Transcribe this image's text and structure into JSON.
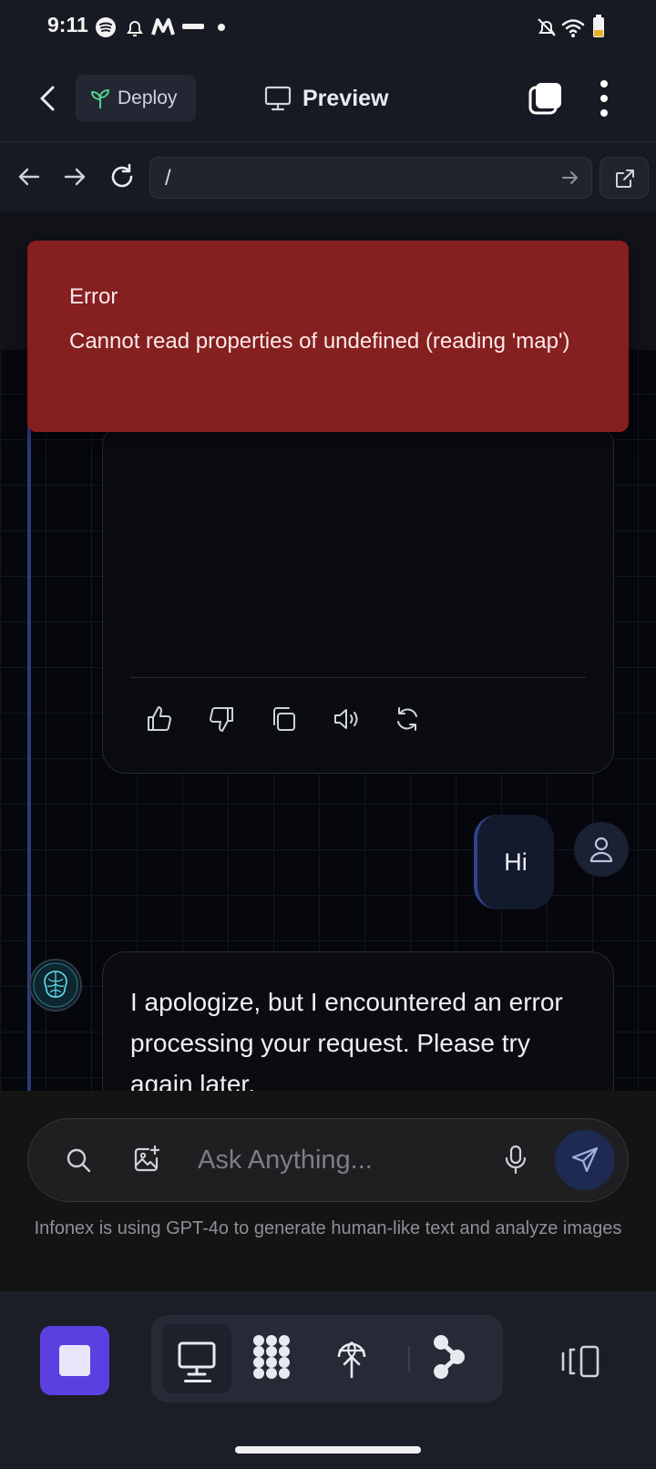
{
  "status_bar": {
    "time": "9:11"
  },
  "header": {
    "deploy_label": "Deploy",
    "title": "Preview"
  },
  "url_bar": {
    "path": "/"
  },
  "toast": {
    "title": "Error",
    "message": "Cannot read properties of undefined (reading 'map')"
  },
  "chat": {
    "user_message": "Hi",
    "bot_message": "I apologize, but I encountered an error processing your request. Please try again later."
  },
  "input": {
    "placeholder": "Ask Anything...",
    "disclaimer": "Infonex is using GPT-4o to generate human-like text and analyze images"
  },
  "colors": {
    "accent_purple": "#5b3fe0",
    "error_red": "#861f1f",
    "send_blue": "#1e2a52",
    "thread_line": "#2b3b7a"
  },
  "icons": {
    "header": [
      "chevron-left-icon",
      "sprout-icon",
      "monitor-icon",
      "tabs-icon",
      "more-vertical-icon"
    ],
    "url_bar": [
      "arrow-left-icon",
      "arrow-right-icon",
      "refresh-icon",
      "arrow-right-small-icon",
      "external-link-icon"
    ],
    "message_actions": [
      "thumbs-up-icon",
      "thumbs-down-icon",
      "copy-icon",
      "speaker-icon",
      "regenerate-icon"
    ],
    "input": [
      "search-icon",
      "image-add-icon",
      "mic-icon",
      "send-icon"
    ],
    "toolbar": [
      "stop-icon",
      "monitor-icon",
      "grid-dots-icon",
      "deploy-globe-icon",
      "share-nodes-icon",
      "layout-panel-icon"
    ]
  }
}
